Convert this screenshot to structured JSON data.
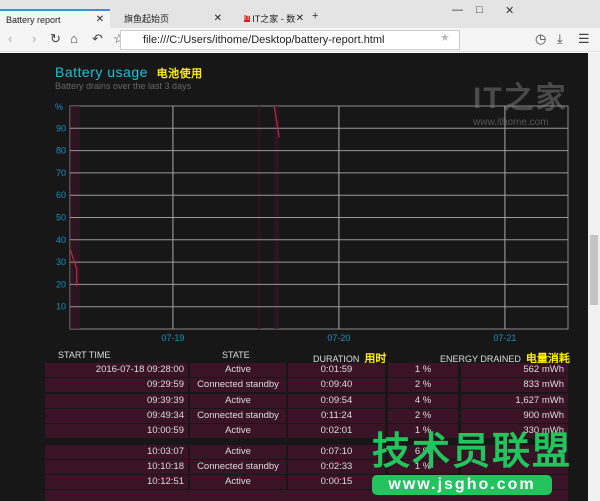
{
  "browser": {
    "tabs": [
      {
        "label": "Battery report",
        "active": true
      },
      {
        "label": "旗鱼起始页"
      },
      {
        "label": "IT之家 - 数码，科技，生"
      }
    ],
    "url": "file:///C:/Users/ithome/Desktop/battery-report.html"
  },
  "report": {
    "title": "Battery usage",
    "title_cn": "电池使用",
    "subtitle": "Battery drains over the last 3 days"
  },
  "chart_data": {
    "type": "line",
    "ylabel": "%",
    "ylim": [
      0,
      100
    ],
    "yticks": [
      10,
      20,
      30,
      40,
      50,
      60,
      70,
      80,
      90
    ],
    "xticks": [
      "07-19",
      "07-20",
      "07-21"
    ],
    "xrange_days": [
      -0.62,
      2.38
    ],
    "series": [
      {
        "name": "battery",
        "segments": [
          [
            [
              -0.62,
              36
            ],
            [
              -0.58,
              27
            ],
            [
              -0.58,
              19
            ]
          ],
          [
            [
              0.61,
              100
            ],
            [
              0.64,
              86
            ]
          ]
        ]
      }
    ],
    "grid": true
  },
  "table": {
    "headers": {
      "start": "START TIME",
      "state": "STATE",
      "duration": "DURATION",
      "duration_cn": "用时",
      "energy": "ENERGY DRAINED",
      "energy_cn": "电量消耗"
    },
    "rows": [
      {
        "start": "2016-07-18 09:28:00",
        "state": "Active",
        "duration": "0:01:59",
        "pct": "1 %",
        "mwh": "562 mWh"
      },
      {
        "start": "09:29:59",
        "state": "Connected standby",
        "duration": "0:09:40",
        "pct": "2 %",
        "mwh": "833 mWh"
      },
      {
        "start": "09:39:39",
        "state": "Active",
        "duration": "0:09:54",
        "pct": "4 %",
        "mwh": "1,627 mWh"
      },
      {
        "start": "09:49:34",
        "state": "Connected standby",
        "duration": "0:11:24",
        "pct": "2 %",
        "mwh": "900 mWh"
      },
      {
        "start": "10:00:59",
        "state": "Active",
        "duration": "0:02:01",
        "pct": "1 %",
        "mwh": "330 mWh"
      },
      {
        "start": "10:03:07",
        "state": "Active",
        "duration": "0:07:10",
        "pct": "6 %",
        "mwh": ""
      },
      {
        "start": "10:10:18",
        "state": "Connected standby",
        "duration": "0:02:33",
        "pct": "1 %",
        "mwh": ""
      },
      {
        "start": "10:12:51",
        "state": "Active",
        "duration": "0:00:15",
        "pct": "",
        "mwh": ""
      }
    ]
  },
  "watermarks": {
    "ithome_logo": "IT之家",
    "ithome_url": "www.ithome.com",
    "jsgho": "技术员联盟",
    "jsgho_url": "www.jsgho.com"
  },
  "colors": {
    "accent": "#19c3d8",
    "line": "#b0283c",
    "row": "#3a1426"
  }
}
